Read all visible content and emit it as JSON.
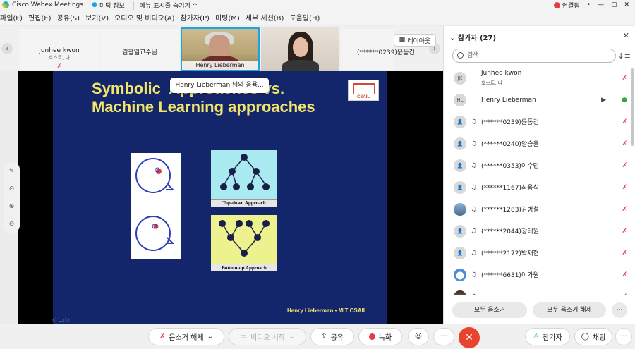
{
  "titlebar": {
    "app": "Cisco Webex Meetings",
    "meeting_info": "미팅 정보",
    "hide_menu": "메뉴 표시줄 숨기기 ^",
    "connection": "연결됨"
  },
  "menubar": [
    "파일(F)",
    "편집(E)",
    "공유(S)",
    "보기(V)",
    "오디오 및 비디오(A)",
    "참가자(P)",
    "미팅(M)",
    "세부 세션(B)",
    "도움말(H)"
  ],
  "thumbnails": {
    "t1_name": "junhee kwon",
    "t1_sub": "호스트, 나",
    "t2_name": "김광일교수님",
    "t3_name": "Henry Lieberman",
    "t5_name": "(******0239)윤동건",
    "layout_label": "레이아웃"
  },
  "slide": {
    "title": "Symbolic  Approaches vs.\nMachine Learning approaches",
    "tooltip": "Henry Lieberman 님의 응용...",
    "csail_label": "CSAIL",
    "top_down": "Top-down Approach",
    "bottom_up": "Bottom-up Approach",
    "footer": "Henry Lieberman • MIT CSAIL"
  },
  "panel": {
    "title": "참가자 (27)",
    "search_placeholder": "검색",
    "participants": [
      {
        "avatar": "JK",
        "name": "junhee kwon",
        "sub": "호스트, 나",
        "mic": "muted"
      },
      {
        "avatar": "HL",
        "name": "Henry Lieberman",
        "mic": "on"
      },
      {
        "avatar": "",
        "name": "(******0239)윤동건",
        "mic": "muted"
      },
      {
        "avatar": "",
        "name": "(******0240)양승윤",
        "mic": "muted"
      },
      {
        "avatar": "",
        "name": "(******0353)이수민",
        "mic": "muted"
      },
      {
        "avatar": "",
        "name": "(******1167)최용식",
        "mic": "muted"
      },
      {
        "avatar": "",
        "name": "(******1283)김병철",
        "mic": "muted"
      },
      {
        "avatar": "",
        "name": "(******2044)강태원",
        "mic": "muted"
      },
      {
        "avatar": "",
        "name": "(******2172)박재현",
        "mic": "muted"
      },
      {
        "avatar": "",
        "name": "(******6631)이가원",
        "mic": "muted"
      },
      {
        "avatar": "",
        "name": "",
        "mic": "muted"
      }
    ],
    "mute_all": "모두 음소거",
    "unmute_all": "모두 음소거 해제",
    "more": "···"
  },
  "bottombar": {
    "unmute": "음소거 해제",
    "start_video": "비디오 시작",
    "share": "공유",
    "record": "녹화",
    "more": "···",
    "participants": "참가자",
    "chat": "채팅"
  },
  "colors": {
    "slide_bg": "#14266b",
    "slide_title": "#f1e56a",
    "accent": "#1aa4e8",
    "end": "#e8432e",
    "muted": "#e63946"
  }
}
